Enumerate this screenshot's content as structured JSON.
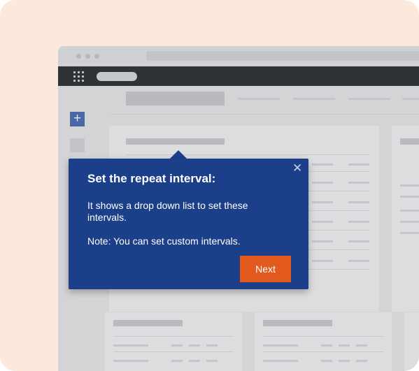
{
  "tooltip": {
    "title": "Set the repeat interval:",
    "body": "It shows a drop down list to set these intervals.",
    "note": "Note: You can set custom intervals.",
    "close_icon": "close-icon",
    "next_label": "Next"
  },
  "colors": {
    "frame_background": "#fde8dc",
    "tooltip_background": "#1c3f8a",
    "next_button": "#e25a1e",
    "navbar": "#2f3337",
    "add_button": "#4a67a8"
  },
  "icons": {
    "apps": "grid-icon",
    "add": "plus-icon"
  }
}
